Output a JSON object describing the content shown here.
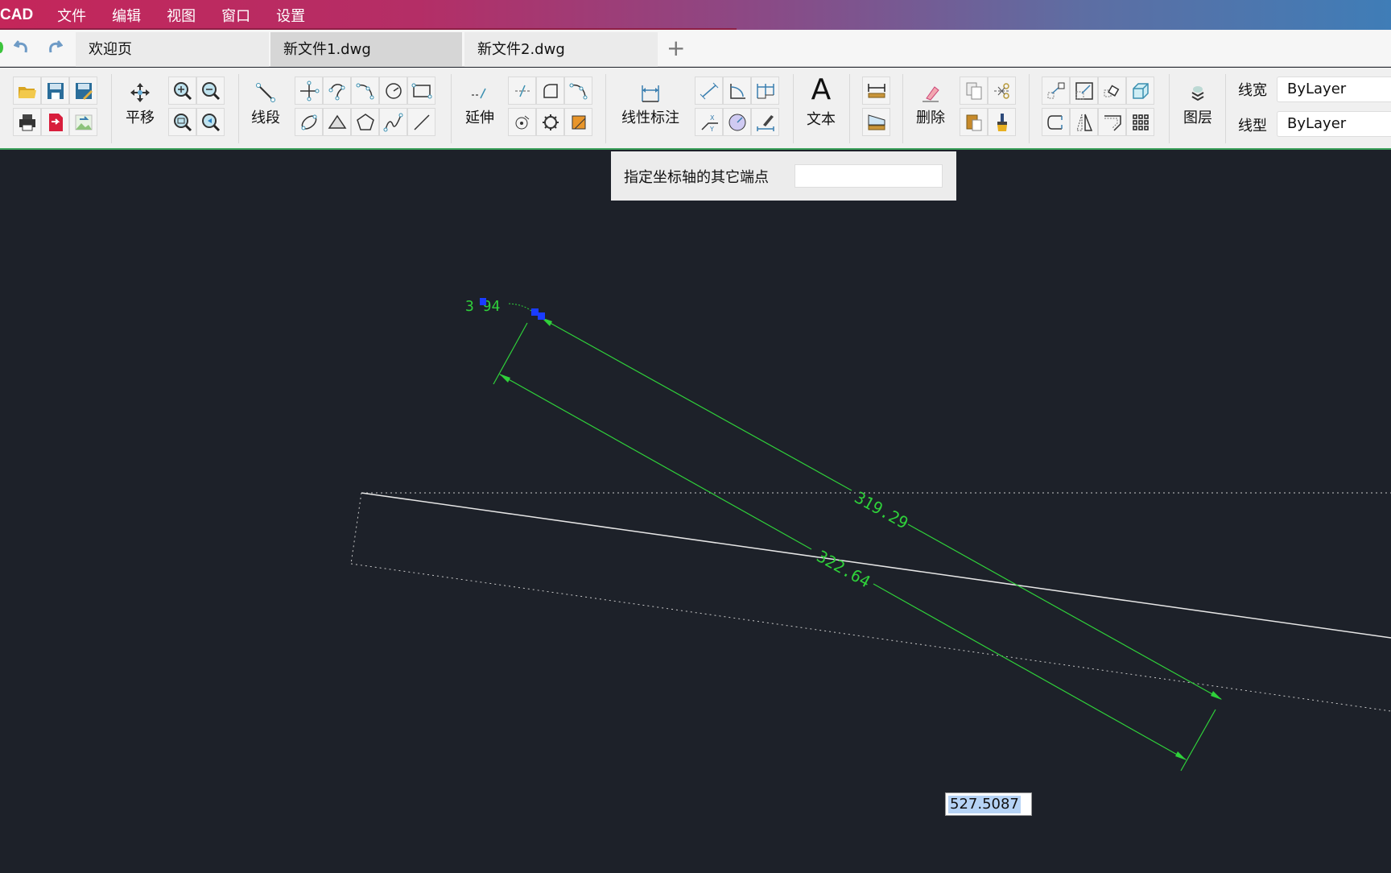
{
  "app": {
    "brand": "CAD"
  },
  "menu": [
    "文件",
    "编辑",
    "视图",
    "窗口",
    "设置"
  ],
  "quick": {
    "undo_icon": "undo-icon",
    "redo_icon": "redo-icon"
  },
  "tabs": [
    {
      "label": "欢迎页",
      "active": false
    },
    {
      "label": "新文件1.dwg",
      "active": true
    },
    {
      "label": "新文件2.dwg",
      "active": false
    }
  ],
  "add_tab": "+",
  "toolbar": {
    "pan": "平移",
    "line": "线段",
    "extend": "延伸",
    "linear_dim": "线性标注",
    "text": "文本",
    "text_glyph": "A",
    "delete": "删除",
    "layer": "图层",
    "lineweight_label": "线宽",
    "lineweight_value": "ByLayer",
    "linetype_label": "线型",
    "linetype_value": "ByLayer"
  },
  "prompt": {
    "text": "指定坐标轴的其它端点",
    "value": ""
  },
  "drawing": {
    "dim_upper": "319.29",
    "dim_lower": "322.64",
    "dim_small": "3 94",
    "dynamic_input": "527.5087",
    "colors": {
      "background": "#1d2129",
      "dimension": "#2fd13a",
      "geometry": "#e6e6e6",
      "grip": "#1a3cff"
    }
  }
}
